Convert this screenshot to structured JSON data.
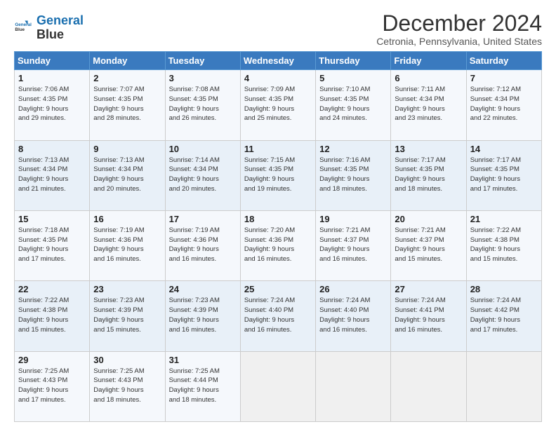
{
  "header": {
    "logo_line1": "General",
    "logo_line2": "Blue",
    "title": "December 2024",
    "subtitle": "Cetronia, Pennsylvania, United States"
  },
  "columns": [
    "Sunday",
    "Monday",
    "Tuesday",
    "Wednesday",
    "Thursday",
    "Friday",
    "Saturday"
  ],
  "weeks": [
    [
      {
        "day": "1",
        "info": "Sunrise: 7:06 AM\nSunset: 4:35 PM\nDaylight: 9 hours\nand 29 minutes."
      },
      {
        "day": "2",
        "info": "Sunrise: 7:07 AM\nSunset: 4:35 PM\nDaylight: 9 hours\nand 28 minutes."
      },
      {
        "day": "3",
        "info": "Sunrise: 7:08 AM\nSunset: 4:35 PM\nDaylight: 9 hours\nand 26 minutes."
      },
      {
        "day": "4",
        "info": "Sunrise: 7:09 AM\nSunset: 4:35 PM\nDaylight: 9 hours\nand 25 minutes."
      },
      {
        "day": "5",
        "info": "Sunrise: 7:10 AM\nSunset: 4:35 PM\nDaylight: 9 hours\nand 24 minutes."
      },
      {
        "day": "6",
        "info": "Sunrise: 7:11 AM\nSunset: 4:34 PM\nDaylight: 9 hours\nand 23 minutes."
      },
      {
        "day": "7",
        "info": "Sunrise: 7:12 AM\nSunset: 4:34 PM\nDaylight: 9 hours\nand 22 minutes."
      }
    ],
    [
      {
        "day": "8",
        "info": "Sunrise: 7:13 AM\nSunset: 4:34 PM\nDaylight: 9 hours\nand 21 minutes."
      },
      {
        "day": "9",
        "info": "Sunrise: 7:13 AM\nSunset: 4:34 PM\nDaylight: 9 hours\nand 20 minutes."
      },
      {
        "day": "10",
        "info": "Sunrise: 7:14 AM\nSunset: 4:34 PM\nDaylight: 9 hours\nand 20 minutes."
      },
      {
        "day": "11",
        "info": "Sunrise: 7:15 AM\nSunset: 4:35 PM\nDaylight: 9 hours\nand 19 minutes."
      },
      {
        "day": "12",
        "info": "Sunrise: 7:16 AM\nSunset: 4:35 PM\nDaylight: 9 hours\nand 18 minutes."
      },
      {
        "day": "13",
        "info": "Sunrise: 7:17 AM\nSunset: 4:35 PM\nDaylight: 9 hours\nand 18 minutes."
      },
      {
        "day": "14",
        "info": "Sunrise: 7:17 AM\nSunset: 4:35 PM\nDaylight: 9 hours\nand 17 minutes."
      }
    ],
    [
      {
        "day": "15",
        "info": "Sunrise: 7:18 AM\nSunset: 4:35 PM\nDaylight: 9 hours\nand 17 minutes."
      },
      {
        "day": "16",
        "info": "Sunrise: 7:19 AM\nSunset: 4:36 PM\nDaylight: 9 hours\nand 16 minutes."
      },
      {
        "day": "17",
        "info": "Sunrise: 7:19 AM\nSunset: 4:36 PM\nDaylight: 9 hours\nand 16 minutes."
      },
      {
        "day": "18",
        "info": "Sunrise: 7:20 AM\nSunset: 4:36 PM\nDaylight: 9 hours\nand 16 minutes."
      },
      {
        "day": "19",
        "info": "Sunrise: 7:21 AM\nSunset: 4:37 PM\nDaylight: 9 hours\nand 16 minutes."
      },
      {
        "day": "20",
        "info": "Sunrise: 7:21 AM\nSunset: 4:37 PM\nDaylight: 9 hours\nand 15 minutes."
      },
      {
        "day": "21",
        "info": "Sunrise: 7:22 AM\nSunset: 4:38 PM\nDaylight: 9 hours\nand 15 minutes."
      }
    ],
    [
      {
        "day": "22",
        "info": "Sunrise: 7:22 AM\nSunset: 4:38 PM\nDaylight: 9 hours\nand 15 minutes."
      },
      {
        "day": "23",
        "info": "Sunrise: 7:23 AM\nSunset: 4:39 PM\nDaylight: 9 hours\nand 15 minutes."
      },
      {
        "day": "24",
        "info": "Sunrise: 7:23 AM\nSunset: 4:39 PM\nDaylight: 9 hours\nand 16 minutes."
      },
      {
        "day": "25",
        "info": "Sunrise: 7:24 AM\nSunset: 4:40 PM\nDaylight: 9 hours\nand 16 minutes."
      },
      {
        "day": "26",
        "info": "Sunrise: 7:24 AM\nSunset: 4:40 PM\nDaylight: 9 hours\nand 16 minutes."
      },
      {
        "day": "27",
        "info": "Sunrise: 7:24 AM\nSunset: 4:41 PM\nDaylight: 9 hours\nand 16 minutes."
      },
      {
        "day": "28",
        "info": "Sunrise: 7:24 AM\nSunset: 4:42 PM\nDaylight: 9 hours\nand 17 minutes."
      }
    ],
    [
      {
        "day": "29",
        "info": "Sunrise: 7:25 AM\nSunset: 4:43 PM\nDaylight: 9 hours\nand 17 minutes."
      },
      {
        "day": "30",
        "info": "Sunrise: 7:25 AM\nSunset: 4:43 PM\nDaylight: 9 hours\nand 18 minutes."
      },
      {
        "day": "31",
        "info": "Sunrise: 7:25 AM\nSunset: 4:44 PM\nDaylight: 9 hours\nand 18 minutes."
      },
      {
        "day": "",
        "info": ""
      },
      {
        "day": "",
        "info": ""
      },
      {
        "day": "",
        "info": ""
      },
      {
        "day": "",
        "info": ""
      }
    ]
  ]
}
